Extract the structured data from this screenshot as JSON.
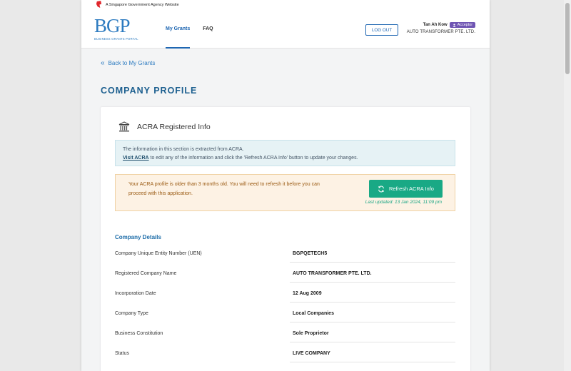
{
  "gov_bar": {
    "text": "A Singapore Government Agency Website",
    "icon": "lion-head-icon"
  },
  "header": {
    "logo_mark": "BGP",
    "logo_sub": "BUSINESS GRANTS PORTAL",
    "nav": [
      {
        "label": "My Grants",
        "active": true
      },
      {
        "label": "FAQ",
        "active": false
      }
    ],
    "logout_label": "LOG OUT",
    "user_name": "Tan Ah Kow",
    "role_badge": "Acceptor",
    "company_name": "AUTO TRANSFORMER PTE. LTD."
  },
  "back_link": "Back to My Grants",
  "page_title": "COMPANY PROFILE",
  "acra": {
    "title": "ACRA Registered Info",
    "info_line1": "The information in this section is extracted from ACRA.",
    "info_visit": "Visit ACRA",
    "info_line2": " to edit any of the information and click the 'Refresh ACRA Info' button to update your changes.",
    "warning": "Your ACRA profile is older than 3 months old. You will need to refresh it before you can proceed with this application.",
    "refresh_label": "Refresh ACRA Info",
    "last_updated": "Last updated:  13 Jan 2024, 11:09 pm"
  },
  "company_details": {
    "title": "Company Details",
    "rows": [
      {
        "label": "Company Unique Entity Number (UEN)",
        "value": "BGPQETECH5"
      },
      {
        "label": "Registered Company Name",
        "value": "AUTO TRANSFORMER PTE. LTD."
      },
      {
        "label": "Incorporation Date",
        "value": "12 Aug 2009"
      },
      {
        "label": "Company Type",
        "value": "Local Companies"
      },
      {
        "label": "Business Constitution",
        "value": "Sole Proprietor"
      },
      {
        "label": "Status",
        "value": "LIVE COMPANY"
      }
    ]
  },
  "colors": {
    "brand_blue": "#1e66b2",
    "title_blue": "#1c5f8f",
    "refresh_green": "#19a985",
    "badge_purple": "#6f55b3",
    "warning_bg": "#fdf2e4",
    "info_bg": "#e6f2f5"
  }
}
